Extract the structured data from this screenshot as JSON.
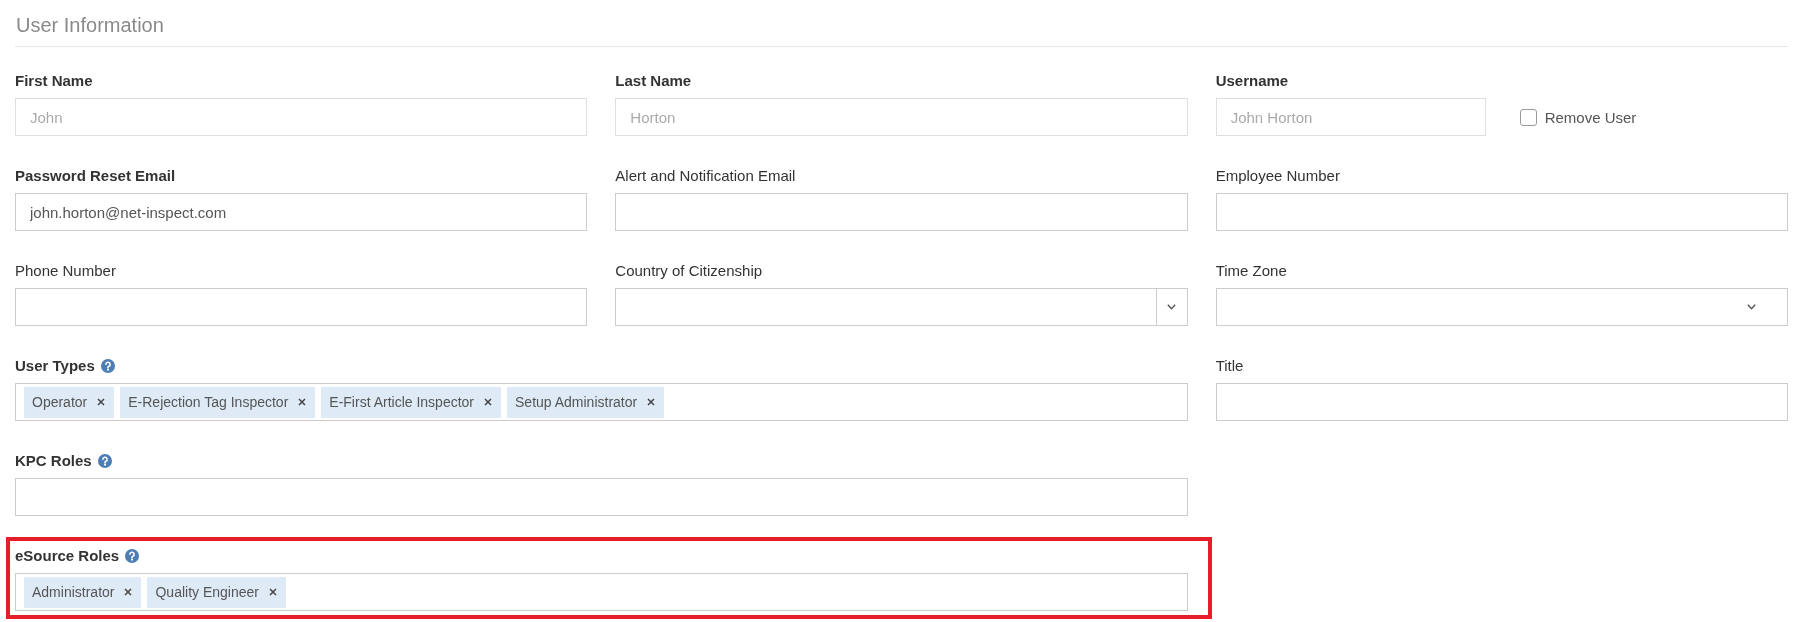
{
  "section": {
    "title": "User Information"
  },
  "fields": [
    {
      "kind": "text",
      "label": "First Name",
      "required": true,
      "help": false,
      "disabled": true,
      "highlighted": false,
      "value": "John"
    },
    {
      "kind": "text",
      "label": "Last Name",
      "required": true,
      "help": false,
      "disabled": true,
      "highlighted": false,
      "value": "Horton"
    },
    {
      "kind": "text",
      "label": "Username",
      "required": true,
      "help": false,
      "disabled": true,
      "highlighted": false,
      "value": "John Horton",
      "checkbox": {
        "label": "Remove User",
        "checked": false
      }
    },
    {
      "kind": "text",
      "label": "Password Reset Email",
      "required": true,
      "help": false,
      "disabled": false,
      "highlighted": false,
      "value": "john.horton@net-inspect.com"
    },
    {
      "kind": "text",
      "label": "Alert and Notification Email",
      "required": false,
      "help": false,
      "disabled": false,
      "highlighted": false
    },
    {
      "kind": "text",
      "label": "Employee Number",
      "required": false,
      "help": false,
      "disabled": false,
      "highlighted": false
    },
    {
      "kind": "text",
      "label": "Phone Number",
      "required": false,
      "help": false,
      "disabled": false,
      "highlighted": false
    },
    {
      "kind": "combo",
      "label": "Country of Citizenship",
      "required": false,
      "help": false,
      "disabled": false,
      "highlighted": false
    },
    {
      "kind": "select",
      "label": "Time Zone",
      "required": false,
      "help": false,
      "disabled": false,
      "highlighted": false
    },
    {
      "kind": "tags",
      "label": "User Types",
      "required": true,
      "help": true,
      "disabled": false,
      "highlighted": false,
      "tags": [
        "Operator",
        "E-Rejection Tag Inspector",
        "E-First Article Inspector",
        "Setup Administrator"
      ]
    },
    {
      "kind": "text",
      "label": "Title",
      "required": false,
      "help": false,
      "disabled": false,
      "highlighted": false
    },
    {
      "kind": "tags",
      "label": "KPC Roles",
      "required": true,
      "help": true,
      "disabled": false,
      "highlighted": false
    },
    {
      "kind": "tags",
      "label": "eSource Roles",
      "required": true,
      "help": true,
      "disabled": false,
      "highlighted": true,
      "tags": [
        "Administrator",
        "Quality Engineer"
      ]
    }
  ]
}
